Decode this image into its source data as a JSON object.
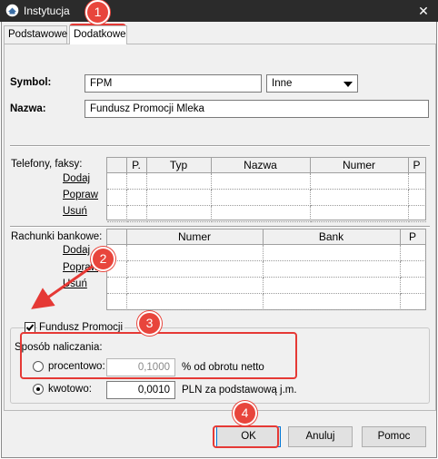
{
  "window": {
    "title": "Instytucja",
    "close_glyph": "✕",
    "icon": "app-icon"
  },
  "tabs": [
    {
      "label": "Podstawowe",
      "active": false
    },
    {
      "label": "Dodatkowe",
      "active": true
    }
  ],
  "form": {
    "symbol_label": "Symbol:",
    "symbol_value": "FPM",
    "type_value": "Inne",
    "name_label": "Nazwa:",
    "name_value": "Fundusz Promocji Mleka"
  },
  "phones": {
    "label": "Telefony, faksy:",
    "columns": [
      "P.",
      "Typ",
      "Nazwa",
      "Numer",
      "P"
    ],
    "actions": [
      "Dodaj",
      "Popraw",
      "Usuń"
    ]
  },
  "accounts": {
    "label": "Rachunki bankowe:",
    "columns": [
      "Numer",
      "Bank",
      "P"
    ],
    "actions": [
      "Dodaj",
      "Popraw",
      "Usuń"
    ]
  },
  "fund": {
    "checkbox_label": "Fundusz Promocji",
    "checked": true,
    "method_label": "Sposób naliczania:",
    "percent_label": "procentowo:",
    "percent_value": "0,1000",
    "percent_unit": "% od obrotu netto",
    "amount_label": "kwotowo:",
    "amount_value": "0,0010",
    "amount_unit": "PLN za podstawową j.m.",
    "selected": "kwotowo"
  },
  "buttons": {
    "ok": "OK",
    "cancel": "Anuluj",
    "help": "Pomoc"
  },
  "annotations": [
    "1",
    "2",
    "3",
    "4"
  ],
  "colors": {
    "annotation": "#e53935",
    "titlebar": "#2b2b2b",
    "dialog_bg": "#f0f0f0"
  }
}
